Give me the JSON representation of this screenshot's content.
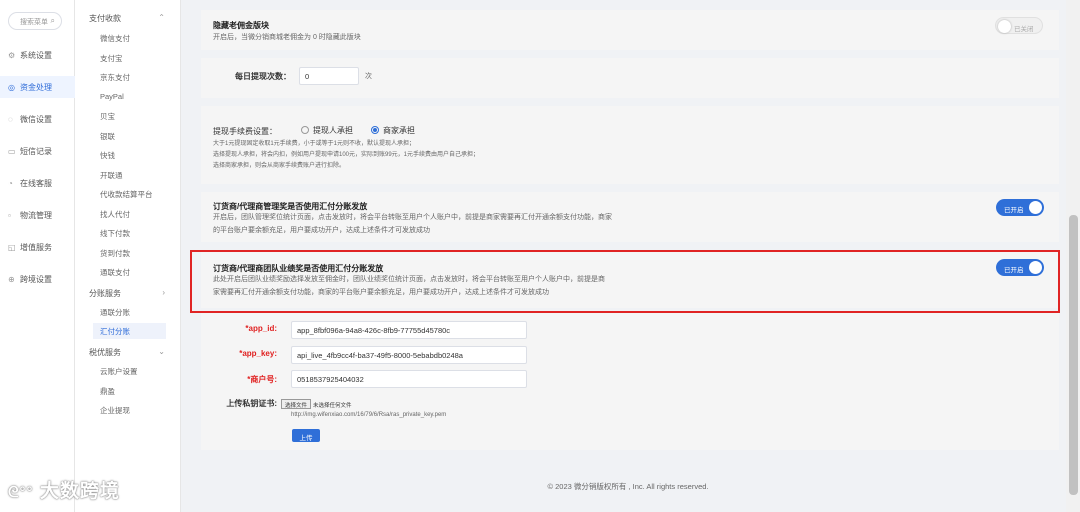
{
  "left_nav": {
    "search_placeholder": "搜索菜单",
    "items": [
      {
        "label": "系统设置",
        "icon": "gear-icon"
      },
      {
        "label": "资金处理",
        "icon": "money-icon"
      },
      {
        "label": "微信设置",
        "icon": "wechat-icon"
      },
      {
        "label": "短信记录",
        "icon": "sms-icon"
      },
      {
        "label": "在线客服",
        "icon": "headset-icon"
      },
      {
        "label": "物流管理",
        "icon": "truck-icon"
      },
      {
        "label": "增值服务",
        "icon": "chart-icon"
      },
      {
        "label": "跨境设置",
        "icon": "globe-icon"
      }
    ]
  },
  "sub_nav": {
    "groups": [
      {
        "label": "支付收款",
        "items": [
          "微信支付",
          "支付宝",
          "京东支付",
          "PayPal",
          "贝宝",
          "银联",
          "快钱",
          "开联通",
          "代收款结算平台",
          "找人代付",
          "线下付款",
          "货到付款",
          "通联支付"
        ]
      },
      {
        "label": "分账服务",
        "items": [
          "通联分账",
          "汇付分账"
        ]
      },
      {
        "label": "税优服务",
        "items": [
          "云账户设置",
          "鼎盈",
          "企业提现"
        ]
      }
    ]
  },
  "card1": {
    "title": "隐藏老佣金版块",
    "desc": "开启后，当微分销商城老佣金为 0 时隐藏此版块",
    "toggle": "已关闭"
  },
  "card2": {
    "label": "每日提现次数：",
    "value": "0",
    "unit": "次"
  },
  "card3": {
    "label": "提现手续费设置：",
    "option1": "提现人承担",
    "option2": "商家承担",
    "desc": [
      "大于1元提现固定收取1元手续费，小于或等于1元则不收，默认提现人承担；",
      "选择提现人承担，将会内扣，例如用户提现申请100元，实际到账99元，1元手续费由用户自己承担；",
      "选择商家承担，则会从商家手续费账户进行扣除。"
    ]
  },
  "card4": {
    "title": "订货商/代理商管理奖是否使用汇付分账发放",
    "desc": [
      "开启后，团队管理奖位统计页面，点击发放时，将会平台转账至用户个人账户中，前提是商家需要再汇付开通余额支付功能，商家",
      "的平台账户要余额充足，用户要成功开户，达成上述条件才可发放成功"
    ],
    "toggle": "已开启"
  },
  "card5": {
    "title": "订货商/代理商团队业绩奖是否使用汇付分账发放",
    "desc": [
      "此处开启后团队业绩奖励选择发放至佣金时，团队业绩奖位统计页面，点击发放时，将会平台转账至用户个人账户中，前提是商",
      "家需要再汇付开通余额支付功能，商家的平台账户要余额充足，用户要成功开户，达成上述条件才可发放成功"
    ],
    "toggle": "已开启"
  },
  "form": {
    "app_id_label": "app_id:",
    "app_id": "app_8fbf096a-94a8-426c-8fb9-77755d45780c",
    "app_key_label": "app_key:",
    "app_key": "api_live_4fb9cc4f-ba37-49f5-8000-5ebabdb0248a",
    "merchant_label": "商户号:",
    "merchant": "0518537925404032",
    "cert_label": "上传私钥证书:",
    "file_button": "选择文件",
    "file_status": "未选择任何文件",
    "cert_path": "http://img.wifenxiao.com/16/79/6/Rsa/ras_private_key.pem",
    "upload_button": "上传"
  },
  "footer": "© 2023 微分销版权所有 , Inc. All rights reserved.",
  "watermark": "大数跨境"
}
